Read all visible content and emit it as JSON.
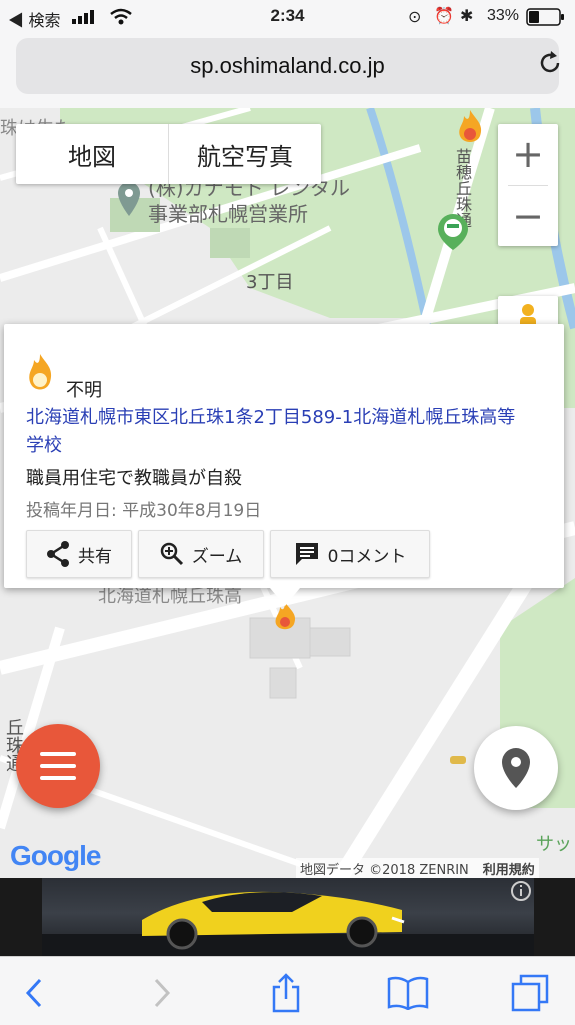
{
  "status_bar": {
    "back_app": "検索",
    "time": "2:34",
    "battery_percent": "33%"
  },
  "browser": {
    "url": "sp.oshimaland.co.jp"
  },
  "map": {
    "map_type": {
      "map_label": "地図",
      "satellite_label": "航空写真"
    },
    "labels": {
      "company": "(株)カナモト レンタル",
      "company2": "事業部札幌営業所",
      "block": "3丁目",
      "road_right": "苗穂丘珠通",
      "road_left": "丘珠通",
      "school_faded": "北海道札幌丘珠高",
      "sapporo": "サッ",
      "top_left": "珠は生た"
    },
    "info_window": {
      "title": "不明",
      "address": "北海道札幌市東区北丘珠1条2丁目589-1北海道札幌丘珠高等学校",
      "description": "職員用住宅で教職員が自殺",
      "date": "投稿年月日: 平成30年8月19日",
      "share_label": "共有",
      "zoom_label": "ズーム",
      "comments_label": "0コメント"
    },
    "google_logo": "Google",
    "attribution": "地図データ ©2018 ZENRIN",
    "terms": "利用規約"
  },
  "colors": {
    "accent_fab": "#e8573a",
    "link": "#2a3fb5",
    "park": "#cfe8c3"
  }
}
